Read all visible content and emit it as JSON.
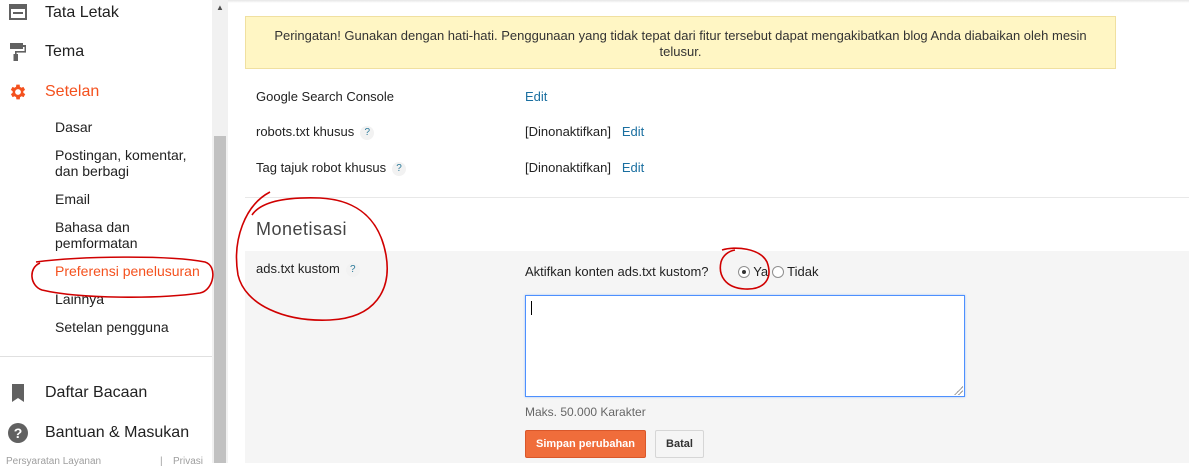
{
  "sidebar": {
    "nav": [
      {
        "label": "Tata Letak",
        "icon": "layout-icon"
      },
      {
        "label": "Tema",
        "icon": "paint-roller-icon"
      },
      {
        "label": "Setelan",
        "icon": "gear-icon"
      }
    ],
    "sub_items": [
      "Dasar",
      "Postingan, komentar,",
      "dan berbagi",
      "Email",
      "Bahasa dan",
      "pemformatan",
      "Preferensi penelusuran",
      "Lainnya",
      "Setelan pengguna"
    ],
    "bottom_nav": [
      {
        "label": "Daftar Bacaan",
        "icon": "bookmark-icon"
      },
      {
        "label": "Bantuan & Masukan",
        "icon": "help-circle-icon"
      }
    ],
    "footer": {
      "terms": "Persyaratan Layanan",
      "separator": "|",
      "privacy": "Privasi"
    }
  },
  "main": {
    "warning": "Peringatan! Gunakan dengan hati-hati. Penggunaan yang tidak tepat dari fitur tersebut dapat mengakibatkan blog Anda diabaikan oleh mesin telusur.",
    "rows": [
      {
        "label": "Google Search Console",
        "help": "",
        "value": "",
        "link": "Edit"
      },
      {
        "label": "robots.txt khusus",
        "help": "?",
        "value": "[Dinonaktifkan]",
        "link": "Edit"
      },
      {
        "label": "Tag tajuk robot khusus",
        "help": "?",
        "value": "[Dinonaktifkan]",
        "link": "Edit"
      }
    ],
    "section_title": "Monetisasi",
    "ads": {
      "label": "ads.txt kustom",
      "help": "?",
      "question": "Aktifkan konten ads.txt kustom?",
      "option_yes": "Ya",
      "option_no": "Tidak",
      "selected": "Ya",
      "textarea_value": "",
      "max_note": "Maks. 50.000 Karakter",
      "save_label": "Simpan perubahan",
      "cancel_label": "Batal"
    }
  },
  "colors": {
    "accent": "#f4511e",
    "link": "#1a6fa0",
    "warning_bg": "#fff6c4",
    "annotation": "#d00000"
  }
}
